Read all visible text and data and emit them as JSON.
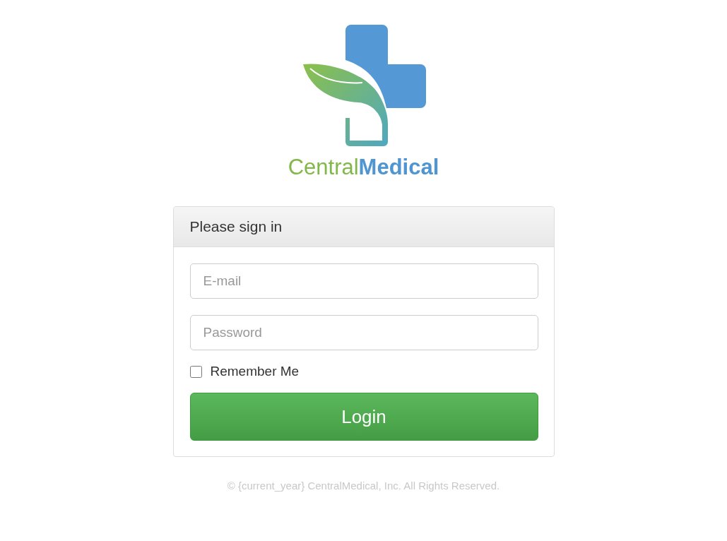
{
  "logo": {
    "wordmark": "Central**Medical**"
  },
  "panel": {
    "heading": "Please sign in"
  },
  "fields": [
    {
      "placeholder": "E-mail"
    },
    {
      "placeholder": "Password"
    }
  ],
  "remember": {
    "label": "Remember Me",
    "checked": false
  },
  "button": {
    "label": "Login"
  },
  "footer": "© {current_year} CentralMedical, Inc. All Rights Reserved."
}
